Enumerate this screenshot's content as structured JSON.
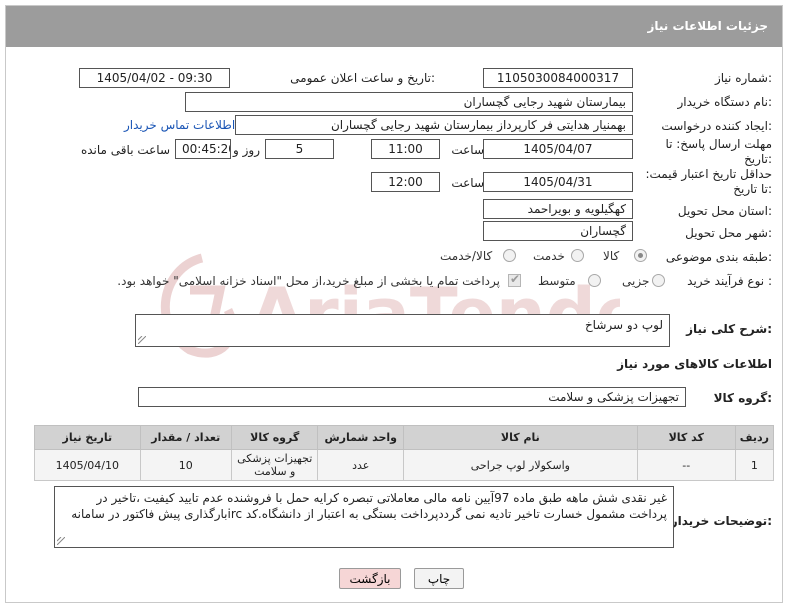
{
  "header": {
    "title": "جزئیات اطلاعات نیاز"
  },
  "labels": {
    "need_number": "شماره نیاز:",
    "announce_datetime": "تاریخ و ساعت اعلان عمومی:",
    "buyer_name": "نام دستگاه خریدار:",
    "request_creator": "ایجاد کننده درخواست:",
    "deadline": "مهلت ارسال پاسخ: تا تاریخ:",
    "min_price_validity": "حداقل تاریخ اعتبار قیمت: تا تاریخ:",
    "delivery_province": "استان محل تحویل:",
    "delivery_city": "شهر محل تحویل:",
    "category": "طبقه بندی موضوعی:",
    "purchase_process": "نوع فرآیند خرید :",
    "time": "ساعت",
    "time2": "ساعت",
    "day_and": "روز و",
    "remaining": "ساعت باقی مانده",
    "general_desc": "شرح کلی نیاز:",
    "goods_info": "اطلاعات کالاهای مورد نیاز",
    "goods_group": "گروه کالا:",
    "buyer_notes": "توضیحات خریدار:"
  },
  "fields": {
    "need_number": "1105030084000317",
    "announce_datetime": "1405/04/02 - 09:30",
    "buyer_name": "بیمارستان شهید رجایی گچساران",
    "request_creator": "بهمنیار هدایتی فر کارپرداز بیمارستان شهید رجایی گچساران",
    "contact_link": "اطلاعات تماس خریدار",
    "deadline_date": "1405/04/07",
    "deadline_time": "11:00",
    "deadline_days": "5",
    "remaining_time": "00:45:20",
    "price_validity_date": "1405/04/31",
    "price_validity_time": "12:00",
    "province": "کهگیلویه و بویراحمد",
    "city": "گچساران",
    "general_desc": "لوپ دو سرشاخ",
    "goods_group": "تجهیزات پزشکی و سلامت",
    "buyer_notes": "غیر نقدی شش ماهه طبق ماده 97آیین نامه مالی معاملاتی تبصره کرایه حمل با فروشنده عدم تایید کیفیت ،تاخیر در پرداخت مشمول خسارت تاخیر تادیه نمی گرددپرداخت بستگی به اعتبار از دانشگاه.کد ircبارگذاری پیش فاکتور در سامانه"
  },
  "category_options": [
    {
      "label": "کالا",
      "selected": true
    },
    {
      "label": "خدمت",
      "selected": false
    },
    {
      "label": "کالا/خدمت",
      "selected": false
    }
  ],
  "process_options": [
    {
      "label": "جزیی",
      "selected": false
    },
    {
      "label": "متوسط",
      "selected": false
    }
  ],
  "payment_note": "پرداخت تمام یا بخشی از مبلغ خرید،از محل \"اسناد خزانه اسلامی\" خواهد بود.",
  "table": {
    "headers": [
      "ردیف",
      "کد کالا",
      "نام کالا",
      "واحد شمارش",
      "گروه کالا",
      "تعداد / مقدار",
      "تاریخ نیاز"
    ],
    "rows": [
      [
        "1",
        "--",
        "واسکولار لوپ جراحی",
        "عدد",
        "تجهیزات پزشکی و سلامت",
        "10",
        "1405/04/10"
      ]
    ]
  },
  "buttons": {
    "print": "چاپ",
    "back": "بازگشت"
  },
  "watermark": "AriaTender.net",
  "colors": {
    "header_bg": "#9c9c9c",
    "link": "#1a55b5",
    "back_button": "#f6d6d6",
    "watermark": "#e9c8c8"
  }
}
